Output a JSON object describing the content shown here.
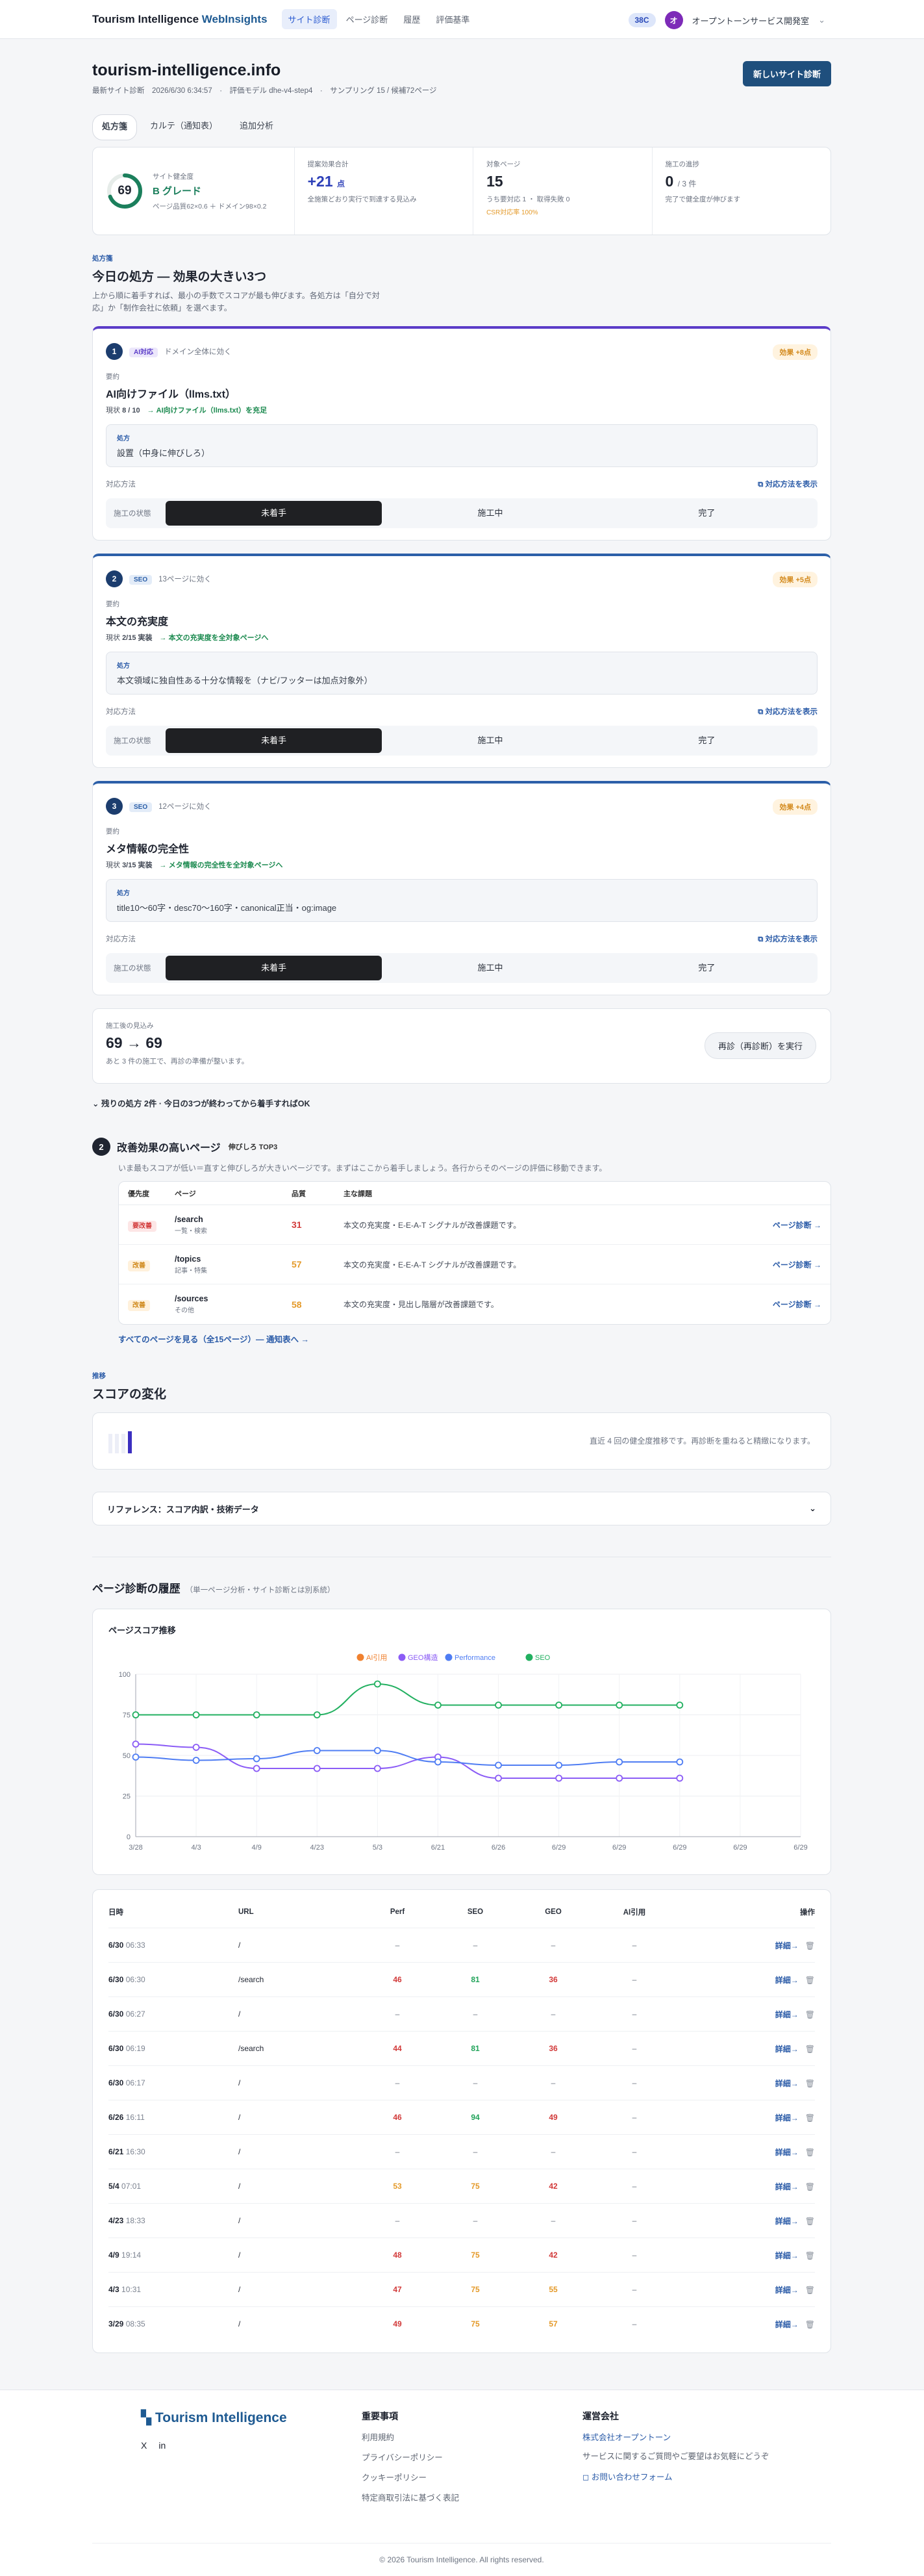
{
  "nav": {
    "brand_a": "Tourism Intelligence",
    "brand_b": "WebInsights",
    "links": [
      "サイト診断",
      "ページ診断",
      "履歴",
      "評価基準"
    ],
    "credit": "38C",
    "avatar": "オ",
    "org": "オープントーンサービス開発室"
  },
  "site": {
    "title": "tourism-intelligence.info",
    "meta": "最新サイト診断　2026/6/30 6:34:57　·　評価モデル dhe-v4-step4　·　サンプリング 15 / 候補72ページ",
    "new_button": "新しいサイト診断",
    "tabs": [
      "処方箋",
      "カルテ（通知表）",
      "追加分析"
    ]
  },
  "stats": {
    "score": "69",
    "score_label": "サイト健全度",
    "grade": "B グレード",
    "score_note": "ページ品質62×0.6 ＋ ドメイン98×0.2",
    "gain_label": "提案効果合計",
    "gain_value": "+21",
    "gain_unit": "点",
    "gain_note": "全施策どおり実行で到達する見込み",
    "target_label": "対象ページ",
    "target_value": "15",
    "target_note": "うち要対応 1 ・ 取得失敗 0",
    "target_sub": "CSR対応率 100%",
    "done_label": "施工の進捗",
    "done_value": "0",
    "done_total": "/ 3 件",
    "done_note": "完了で健全度が伸びます"
  },
  "today": {
    "eyebrow": "処方箋",
    "title": "今日の処方 — 効果の大きい3つ",
    "desc": "上から順に着手すれば、最小の手数でスコアが最も伸びます。各処方は「自分で対応」か「制作会社に依頼」を選べます。"
  },
  "recipes": [
    {
      "num": "1",
      "tag": "AI対応",
      "scope": "ドメイン全体に効く",
      "effect": "効果 +8点",
      "small": "要約",
      "title": "AI向けファイル（llms.txt）",
      "current": "現状 ",
      "current_val": "8 / 10",
      "arrow": "→ AI向けファイル（llms.txt）を充足",
      "presc_label": "処方",
      "presc": "設置（中身に伸びしろ）",
      "how": "対応方法",
      "show_how": "対応方法を表示",
      "state_label": "施工の状態",
      "states": [
        "未着手",
        "施工中",
        "完了"
      ]
    },
    {
      "num": "2",
      "tag": "SEO",
      "scope": "13ページに効く",
      "effect": "効果 +5点",
      "small": "要約",
      "title": "本文の充実度",
      "current": "現状 ",
      "current_val": "2/15 実装",
      "arrow": "→ 本文の充実度を全対象ページへ",
      "presc_label": "処方",
      "presc": "本文領域に独自性ある十分な情報を（ナビ/フッターは加点対象外）",
      "how": "対応方法",
      "show_how": "対応方法を表示",
      "state_label": "施工の状態",
      "states": [
        "未着手",
        "施工中",
        "完了"
      ]
    },
    {
      "num": "3",
      "tag": "SEO",
      "scope": "12ページに効く",
      "effect": "効果 +4点",
      "small": "要約",
      "title": "メタ情報の完全性",
      "current": "現状 ",
      "current_val": "3/15 実装",
      "arrow": "→ メタ情報の完全性を全対象ページへ",
      "presc_label": "処方",
      "presc": "title10〜60字・desc70〜160字・canonical正当・og:image",
      "how": "対応方法",
      "show_how": "対応方法を表示",
      "state_label": "施工の状態",
      "states": [
        "未着手",
        "施工中",
        "完了"
      ]
    }
  ],
  "summary": {
    "label": "施工後の見込み",
    "value": "69 → 69",
    "sub": "あと 3 件の施工で、再診の準備が整います。",
    "rerun": "再診（再診断）を実行",
    "remain": "⌄ 残りの処方 2件 · 今日の3つが終わってから着手すればOK"
  },
  "pages": {
    "num": "2",
    "title": "改善効果の高いページ",
    "top": "伸びしろ TOP3",
    "desc": "いま最もスコアが低い＝直すと伸びしろが大きいページです。まずはここから着手しましょう。各行からそのページの評価に移動できます。",
    "headers": [
      "優先度",
      "ページ",
      "品質",
      "主な課題"
    ],
    "rows": [
      {
        "badge": "要改善",
        "path": "/search",
        "type": "一覧・検索",
        "score": "31",
        "issue": "本文の充実度・E-E-A-T シグナルが改善課題です。",
        "act": "ページ診断 →"
      },
      {
        "badge": "改善",
        "path": "/topics",
        "type": "記事・特集",
        "score": "57",
        "issue": "本文の充実度・E-E-A-T シグナルが改善課題です。",
        "act": "ページ診断 →"
      },
      {
        "badge": "改善",
        "path": "/sources",
        "type": "その他",
        "score": "58",
        "issue": "本文の充実度・見出し階層が改善課題です。",
        "act": "ページ診断 →"
      }
    ],
    "all": "すべてのページを見る（全15ページ）— 通知表へ →"
  },
  "change": {
    "eyebrow": "推移",
    "title": "スコアの変化",
    "note": "直近 4 回の健全度推移です。再診断を重ねると精緻になります。"
  },
  "reference": {
    "label": "リファレンス：スコア内訳・技術データ"
  },
  "history": {
    "title": "ページ診断の履歴",
    "sub": "（単一ページ分析・サイト診断とは別系統）",
    "chart_title": "ページスコア推移",
    "headers": [
      "日時",
      "URL",
      "Perf",
      "SEO",
      "GEO",
      "AI引用",
      "操作"
    ],
    "rows": [
      {
        "date": "6/30",
        "time": "06:33",
        "url": "/",
        "perf": "–",
        "seo": "–",
        "geo": "–",
        "ai": "–"
      },
      {
        "date": "6/30",
        "time": "06:30",
        "url": "/search",
        "perf": "46",
        "seo": "81",
        "geo": "36",
        "ai": "–"
      },
      {
        "date": "6/30",
        "time": "06:27",
        "url": "/",
        "perf": "–",
        "seo": "–",
        "geo": "–",
        "ai": "–"
      },
      {
        "date": "6/30",
        "time": "06:19",
        "url": "/search",
        "perf": "44",
        "seo": "81",
        "geo": "36",
        "ai": "–"
      },
      {
        "date": "6/30",
        "time": "06:17",
        "url": "/",
        "perf": "–",
        "seo": "–",
        "geo": "–",
        "ai": "–"
      },
      {
        "date": "6/26",
        "time": "16:11",
        "url": "/",
        "perf": "46",
        "seo": "94",
        "geo": "49",
        "ai": "–"
      },
      {
        "date": "6/21",
        "time": "16:30",
        "url": "/",
        "perf": "–",
        "seo": "–",
        "geo": "–",
        "ai": "–"
      },
      {
        "date": "5/4",
        "time": "07:01",
        "url": "/",
        "perf": "53",
        "seo": "75",
        "geo": "42",
        "ai": "–"
      },
      {
        "date": "4/23",
        "time": "18:33",
        "url": "/",
        "perf": "–",
        "seo": "–",
        "geo": "–",
        "ai": "–"
      },
      {
        "date": "4/9",
        "time": "19:14",
        "url": "/",
        "perf": "48",
        "seo": "75",
        "geo": "42",
        "ai": "–"
      },
      {
        "date": "4/3",
        "time": "10:31",
        "url": "/",
        "perf": "47",
        "seo": "75",
        "geo": "55",
        "ai": "–"
      },
      {
        "date": "3/29",
        "time": "08:35",
        "url": "/",
        "perf": "49",
        "seo": "75",
        "geo": "57",
        "ai": "–"
      }
    ],
    "detail": "詳細→"
  },
  "chart_data": {
    "type": "line",
    "title": "ページスコア推移",
    "x": [
      "3/28",
      "4/3",
      "4/9",
      "4/23",
      "5/3",
      "6/21",
      "6/26",
      "6/29",
      "6/29",
      "6/29",
      "6/29",
      "6/29"
    ],
    "ylim": [
      0,
      100
    ],
    "yticks": [
      0,
      25,
      50,
      75,
      100
    ],
    "series": [
      {
        "name": "AI引用",
        "color": "#f0812f",
        "values": []
      },
      {
        "name": "GEO構造",
        "color": "#8b5cf6",
        "values": [
          57,
          55,
          42,
          42,
          42,
          49,
          36,
          36,
          36,
          36
        ]
      },
      {
        "name": "Performance",
        "color": "#4f7df3",
        "values": [
          49,
          47,
          48,
          53,
          53,
          46,
          44,
          44,
          46,
          46
        ]
      },
      {
        "name": "SEO",
        "color": "#22b060",
        "values": [
          75,
          75,
          75,
          75,
          94,
          81,
          81,
          81,
          81,
          81
        ]
      }
    ],
    "grid": true,
    "legend": "top-center"
  },
  "footer": {
    "logo": "Tourism Intelligence",
    "social": [
      "X",
      "in"
    ],
    "col2_head": "重要事項",
    "col2_links": [
      "利用規約",
      "プライバシーポリシー",
      "クッキーポリシー",
      "特定商取引法に基づく表記"
    ],
    "col3_head": "運営会社",
    "col3_company": "株式会社オープントーン",
    "col3_note": "サービスに関するご質問やご要望はお気軽にどうぞ",
    "col3_contact": "お問い合わせフォーム",
    "copyright": "© 2026 Tourism Intelligence. All rights reserved."
  }
}
